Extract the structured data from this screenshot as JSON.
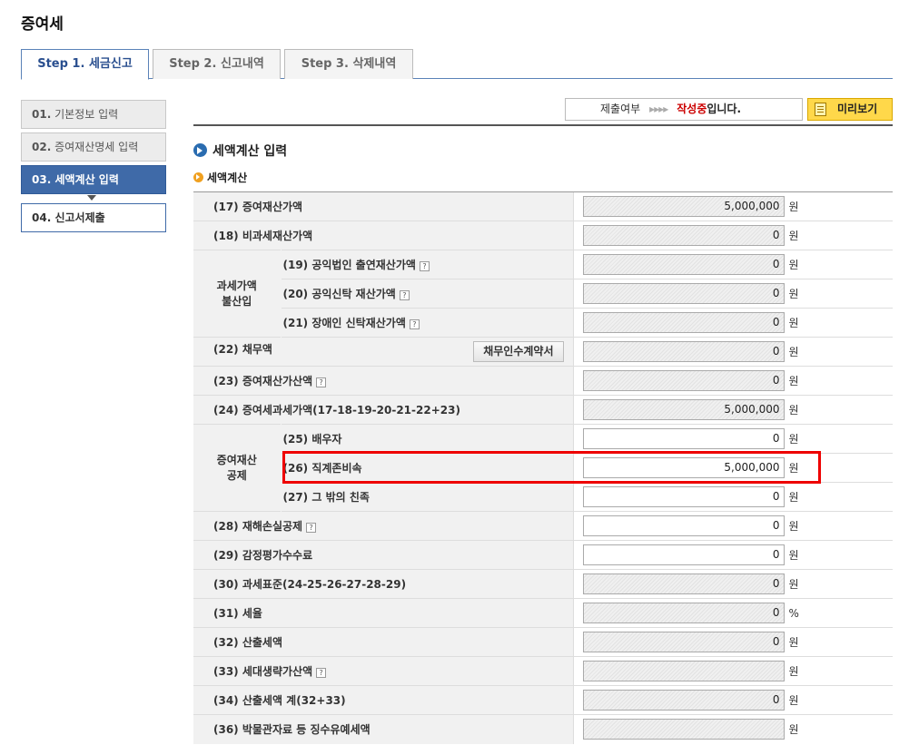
{
  "page_title": "증여세",
  "tabs": [
    {
      "label": "Step 1. 세금신고",
      "active": true
    },
    {
      "label": "Step 2. 신고내역",
      "active": false
    },
    {
      "label": "Step 3. 삭제내역",
      "active": false
    }
  ],
  "side_steps": [
    {
      "num": "01.",
      "label": "기본정보 입력"
    },
    {
      "num": "02.",
      "label": "증여재산명세 입력"
    },
    {
      "num": "03.",
      "label": "세액계산 입력"
    },
    {
      "num": "04.",
      "label": "신고서제출"
    }
  ],
  "status": {
    "label": "제출여부",
    "arrows": "▸▸▸▸",
    "value": "작성중",
    "suffix": "입니다."
  },
  "preview_label": "미리보기",
  "section_title": "세액계산 입력",
  "sub_title": "세액계산",
  "unit_won": "원",
  "unit_pct": "%",
  "help_mark": "?",
  "debt_button": "채무인수계약서",
  "groups": {
    "g1": "과세가액\n불산입",
    "g2": "증여재산\n공제"
  },
  "rows": {
    "r17": {
      "label": "(17) 증여재산가액",
      "value": "5,000,000"
    },
    "r18": {
      "label": "(18) 비과세재산가액",
      "value": "0"
    },
    "r19": {
      "label": "(19) 공익법인 출연재산가액",
      "value": "0"
    },
    "r20": {
      "label": "(20) 공익신탁 재산가액",
      "value": "0"
    },
    "r21": {
      "label": "(21) 장애인 신탁재산가액",
      "value": "0"
    },
    "r22": {
      "label": "(22) 채무액",
      "value": "0"
    },
    "r23": {
      "label": "(23) 증여재산가산액",
      "value": "0"
    },
    "r24": {
      "label": "(24) 증여세과세가액(17-18-19-20-21-22+23)",
      "value": "5,000,000"
    },
    "r25": {
      "label": "(25) 배우자",
      "value": "0"
    },
    "r26": {
      "label": "(26) 직계존비속",
      "value": "5,000,000"
    },
    "r27": {
      "label": "(27) 그 밖의 친족",
      "value": "0"
    },
    "r28": {
      "label": "(28) 재해손실공제",
      "value": "0"
    },
    "r29": {
      "label": "(29) 감정평가수수료",
      "value": "0"
    },
    "r30": {
      "label": "(30) 과세표준(24-25-26-27-28-29)",
      "value": "0"
    },
    "r31": {
      "label": "(31) 세율",
      "value": "0"
    },
    "r32": {
      "label": "(32) 산출세액",
      "value": "0"
    },
    "r33": {
      "label": "(33) 세대생략가산액",
      "value": ""
    },
    "r34": {
      "label": "(34) 산출세액 계(32+33)",
      "value": "0"
    },
    "r36": {
      "label": "(36) 박물관자료 등 징수유예세액",
      "value": ""
    }
  }
}
